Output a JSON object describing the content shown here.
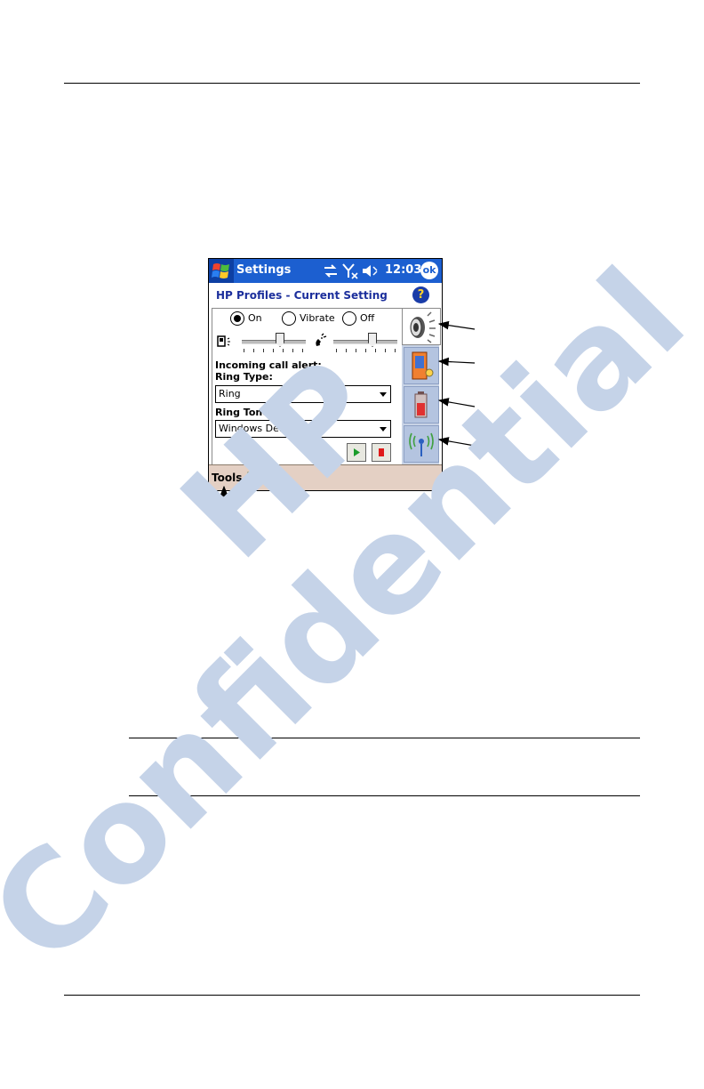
{
  "screen": {
    "app_title": "Settings",
    "clock": "12:03",
    "ok_label": "ok",
    "header": "HP Profiles - Current Setting",
    "help_label": "?",
    "radios": [
      {
        "label": "On",
        "selected": true
      },
      {
        "label": "Vibrate",
        "selected": false
      },
      {
        "label": "Off",
        "selected": false
      }
    ],
    "incoming_call_alert": "Incoming call alert:",
    "ring_type_label": "Ring Type:",
    "ring_type_value": "Ring",
    "ring_tone_label": "Ring Tone:",
    "ring_tone_value": "Windows Default",
    "menu_tools": "Tools",
    "tabs": [
      "speaker-icon",
      "phone-tips-icon",
      "battery-icon",
      "wireless-icon"
    ],
    "colors": {
      "titlebar": "#1c5fd0",
      "header_text": "#1c2f9c",
      "menubar": "#e4d0c4"
    }
  },
  "watermark": {
    "line1": "HP",
    "line2": "Confidential",
    "color": "#c5d3e8"
  }
}
